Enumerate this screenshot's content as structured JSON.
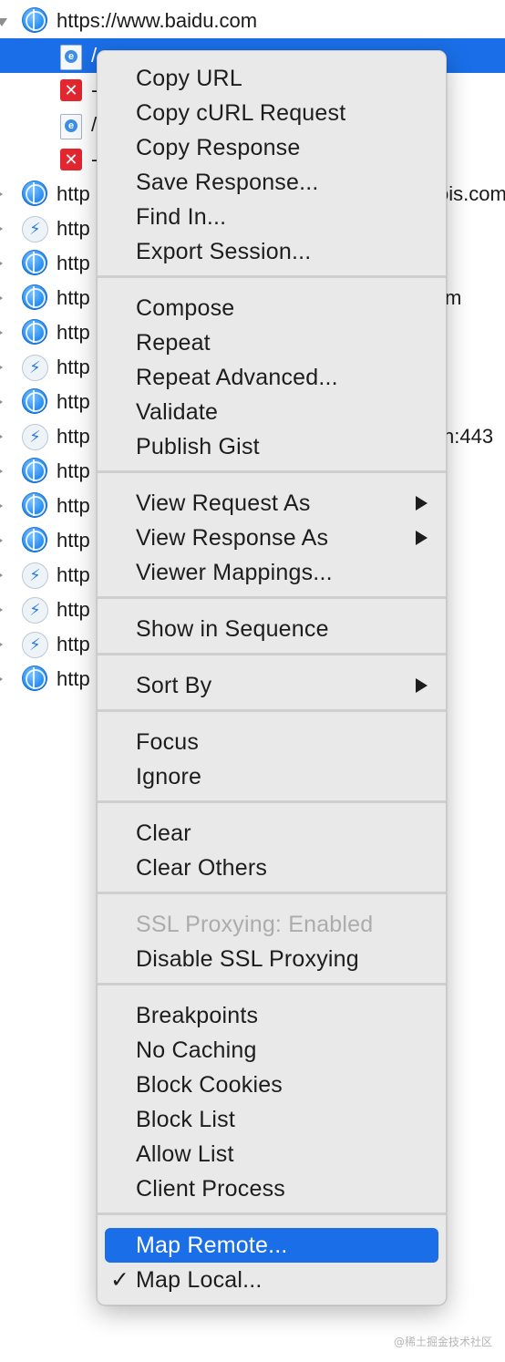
{
  "tree": {
    "root_url": "https://www.baidu.com",
    "child_texts": [
      "/",
      "-",
      "/",
      "-"
    ],
    "row_prefix": "http",
    "tail_texts": [
      "ois.com",
      "m",
      "n:443"
    ]
  },
  "menu": {
    "items": {
      "copy_url": "Copy URL",
      "copy_curl": "Copy cURL Request",
      "copy_response": "Copy Response",
      "save_response": "Save Response...",
      "find_in": "Find In...",
      "export_session": "Export Session...",
      "compose": "Compose",
      "repeat": "Repeat",
      "repeat_advanced": "Repeat Advanced...",
      "validate": "Validate",
      "publish_gist": "Publish Gist",
      "view_request_as": "View Request As",
      "view_response_as": "View Response As",
      "viewer_mappings": "Viewer Mappings...",
      "show_in_sequence": "Show in Sequence",
      "sort_by": "Sort By",
      "focus": "Focus",
      "ignore": "Ignore",
      "clear": "Clear",
      "clear_others": "Clear Others",
      "ssl_status": "SSL Proxying: Enabled",
      "disable_ssl": "Disable SSL Proxying",
      "breakpoints": "Breakpoints",
      "no_caching": "No Caching",
      "block_cookies": "Block Cookies",
      "block_list": "Block List",
      "allow_list": "Allow List",
      "client_process": "Client Process",
      "map_remote": "Map Remote...",
      "map_local": "Map Local..."
    },
    "checkmark": "✓",
    "highlight_color": "#1a6fe8"
  },
  "watermark": "@稀土掘金技术社区"
}
